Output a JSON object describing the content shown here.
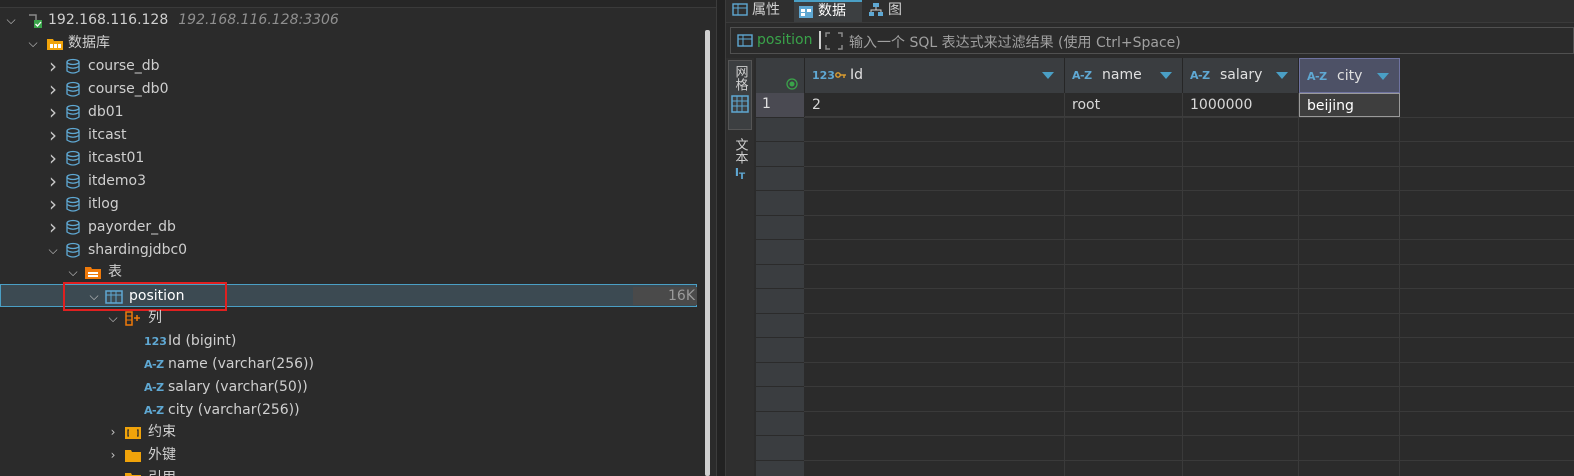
{
  "navigator": {
    "connection": {
      "label": "192.168.116.128",
      "sublabel": "192.168.116.128:3306"
    },
    "databases_folder": "数据库",
    "databases": [
      "course_db",
      "course_db0",
      "db01",
      "itcast",
      "itcast01",
      "itdemo3",
      "itlog",
      "payorder_db",
      "shardingjdbc0"
    ],
    "tables_folder": "表",
    "selected_table": {
      "label": "position",
      "size": "16K"
    },
    "columns_folder": "列",
    "columns": [
      {
        "type_icon": "123",
        "label": "Id (bigint)"
      },
      {
        "type_icon": "A-Z",
        "label": "name (varchar(256))"
      },
      {
        "type_icon": "A-Z",
        "label": "salary (varchar(50))"
      },
      {
        "type_icon": "A-Z",
        "label": "city (varchar(256))"
      }
    ],
    "constraints_folder": "约束",
    "foreign_keys_folder": "外键",
    "references_folder": "引用"
  },
  "editor": {
    "tabs": [
      "属性",
      "数据",
      "图"
    ],
    "active_tab": "数据",
    "filter": {
      "table_name": "position",
      "placeholder": "输入一个 SQL 表达式来过滤结果 (使用 Ctrl+Space)"
    },
    "view_tabs": [
      "网格",
      "文本"
    ],
    "grid": {
      "columns": [
        {
          "type_icon": "123",
          "name": "Id",
          "key": true
        },
        {
          "type_icon": "A-Z",
          "name": "name"
        },
        {
          "type_icon": "A-Z",
          "name": "salary"
        },
        {
          "type_icon": "A-Z",
          "name": "city"
        }
      ],
      "rows": [
        {
          "num": "1",
          "cells": [
            "2",
            "root",
            "1000000",
            "beijing"
          ]
        }
      ]
    },
    "colors": {
      "accent": "#4a9fc5",
      "filter_name": "#3aa34a",
      "highlight_box": "#e02020"
    }
  }
}
